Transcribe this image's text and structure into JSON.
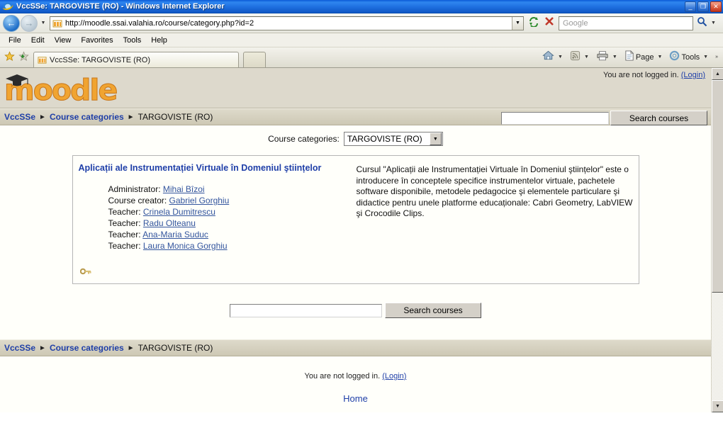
{
  "window": {
    "title": "VccSSe: TARGOVISTE (RO) - Windows Internet Explorer",
    "minimize_label": "_",
    "restore_label": "❐",
    "close_label": "✕"
  },
  "address_bar": {
    "url": "http://moodle.ssai.valahia.ro/course/category.php?id=2",
    "back_arrow": "←",
    "forward_arrow": "→",
    "history_caret": "▼",
    "url_caret": "▼",
    "refresh_icon": "refresh-icon",
    "stop_icon": "stop-icon",
    "search_placeholder": "Google",
    "search_caret": "▼"
  },
  "menu": {
    "items": [
      {
        "label": "File"
      },
      {
        "label": "Edit"
      },
      {
        "label": "View"
      },
      {
        "label": "Favorites"
      },
      {
        "label": "Tools"
      },
      {
        "label": "Help"
      }
    ]
  },
  "tabs": {
    "active_label": "VccSSe: TARGOVISTE (RO)",
    "new_tab_label": ""
  },
  "command_bar": {
    "home_label": "",
    "feeds_label": "",
    "print_label": "",
    "page_label": "Page",
    "tools_label": "Tools",
    "overflow_label": "»",
    "caret": "▼"
  },
  "page": {
    "logo_text": "moodle",
    "login_status": {
      "text": "You are not logged in.",
      "link": "(Login)"
    },
    "breadcrumb": {
      "items": [
        {
          "label": "VccSSe",
          "link": true
        },
        {
          "label": "Course categories",
          "link": true
        },
        {
          "label": "TARGOVISTE (RO)",
          "link": false
        }
      ],
      "separator": "►"
    },
    "header_search": {
      "value": "",
      "button_label": "Search courses"
    },
    "category_select": {
      "label": "Course categories:",
      "selected": "TARGOVISTE (RO)",
      "caret": "▼"
    },
    "course": {
      "name": "Aplicații ale Instrumentației Virtuale în Domeniul ştiințelor",
      "people": [
        {
          "role": "Administrator:",
          "name": "Mihai Bîzoi"
        },
        {
          "role": "Course creator:",
          "name": "Gabriel Gorghiu"
        },
        {
          "role": "Teacher:",
          "name": "Crinela Dumitrescu"
        },
        {
          "role": "Teacher:",
          "name": "Radu Olteanu"
        },
        {
          "role": "Teacher:",
          "name": "Ana-Maria Suduc"
        },
        {
          "role": "Teacher:",
          "name": "Laura Monica Gorghiu"
        }
      ],
      "enrolment_icon": "key-icon",
      "summary": "Cursul \"Aplicații ale Instrumentației Virtuale în Domeniul ştiințelor\" este o introducere în conceptele specifice instrumentelor virtuale, pachetele software disponibile, metodele pedagocice şi elementele particulare şi didactice pentru unele platforme educaționale: Cabri Geometry, LabVIEW şi Crocodile Clips."
    },
    "bottom_search": {
      "value": "",
      "button_label": "Search courses"
    },
    "footer": {
      "login_text": "You are not logged in.",
      "login_link": "(Login)",
      "home_link": "Home"
    }
  },
  "scrollbar": {
    "up_arrow": "▲",
    "down_arrow": "▼"
  }
}
